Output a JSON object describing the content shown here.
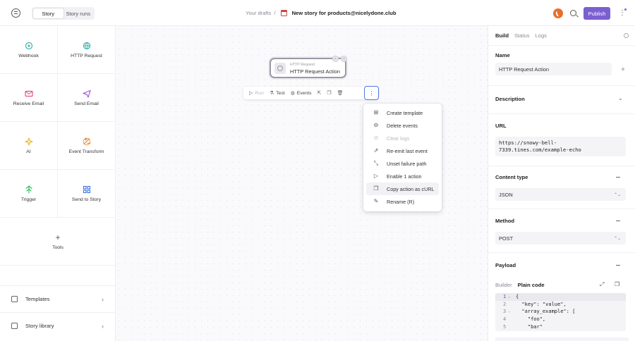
{
  "topbar": {
    "tabs": [
      "Story",
      "Story runs"
    ],
    "active_tab": "Story",
    "breadcrumb_prefix": "Your drafts",
    "breadcrumb_sep": "/",
    "story_title": "New story for products@nicelydone.club",
    "publish_label": "Publish",
    "kebab": "⋮"
  },
  "palette": {
    "items": [
      {
        "label": "Webhook",
        "icon": "webhook-icon",
        "color": "#38b2ac"
      },
      {
        "label": "HTTP Request",
        "icon": "http-request-icon",
        "color": "#38b2ac"
      },
      {
        "label": "Receive Email",
        "icon": "receive-email-icon",
        "color": "#e0527a"
      },
      {
        "label": "Send Email",
        "icon": "send-email-icon",
        "color": "#a05ad6"
      },
      {
        "label": "AI",
        "icon": "ai-icon",
        "color": "#e8b21a"
      },
      {
        "label": "Event Transform",
        "icon": "event-transform-icon",
        "color": "#e8892a"
      },
      {
        "label": "Trigger",
        "icon": "trigger-icon",
        "color": "#3fbf6a"
      },
      {
        "label": "Send to Story",
        "icon": "send-to-story-icon",
        "color": "#3a72e0"
      }
    ],
    "tools_label": "Tools",
    "templates_label": "Templates",
    "story_library_label": "Story library"
  },
  "canvas": {
    "node": {
      "small_label": "HTTP Request",
      "title": "HTTP Request Action"
    },
    "toolbar": {
      "run": "Run",
      "test": "Test",
      "events": "Events",
      "more": "⋮"
    },
    "menu": [
      {
        "label": "Create template",
        "icon": "template-icon",
        "disabled": false
      },
      {
        "label": "Delete events",
        "icon": "delete-events-icon",
        "disabled": false
      },
      {
        "label": "Clear logs",
        "icon": "clear-logs-icon",
        "disabled": true
      },
      {
        "label": "Re-emit last event",
        "icon": "re-emit-icon",
        "disabled": false
      },
      {
        "label": "Unset failure path",
        "icon": "unlink-icon",
        "disabled": false
      },
      {
        "label": "Enable 1 action",
        "icon": "play-icon",
        "disabled": false
      },
      {
        "label": "Copy action as cURL",
        "icon": "copy-icon",
        "disabled": false
      },
      {
        "label": "Rename (R)",
        "icon": "pencil-icon",
        "disabled": false
      }
    ]
  },
  "panel": {
    "tabs": [
      "Build",
      "Status",
      "Logs"
    ],
    "active_tab": "Build",
    "name_label": "Name",
    "name_value": "HTTP Request Action",
    "description_label": "Description",
    "url_label": "URL",
    "url_value": "https://snowy-bell-7339.tines.com/example-echo",
    "url_line1": "https://snowy-bell-",
    "url_line2": "7339.tines.com/example-echo",
    "content_type_label": "Content type",
    "content_type_value": "JSON",
    "method_label": "Method",
    "method_value": "POST",
    "payload_label": "Payload",
    "payload_tabs": [
      "Builder",
      "Plain code"
    ],
    "payload_active_tab": "Plain code",
    "code": [
      {
        "n": "1",
        "text": "{",
        "fold": true
      },
      {
        "n": "2",
        "text": "  \"key\": \"value\",",
        "fold": false
      },
      {
        "n": "3",
        "text": "  \"array_example\": [",
        "fold": true
      },
      {
        "n": "4",
        "text": "    \"foo\",",
        "fold": false
      },
      {
        "n": "5",
        "text": "    \"bar\"",
        "fold": false
      }
    ]
  },
  "colors": {
    "accent": "#7b5fd0",
    "focus": "#4a7ce8",
    "logo": "#e76f2b"
  }
}
